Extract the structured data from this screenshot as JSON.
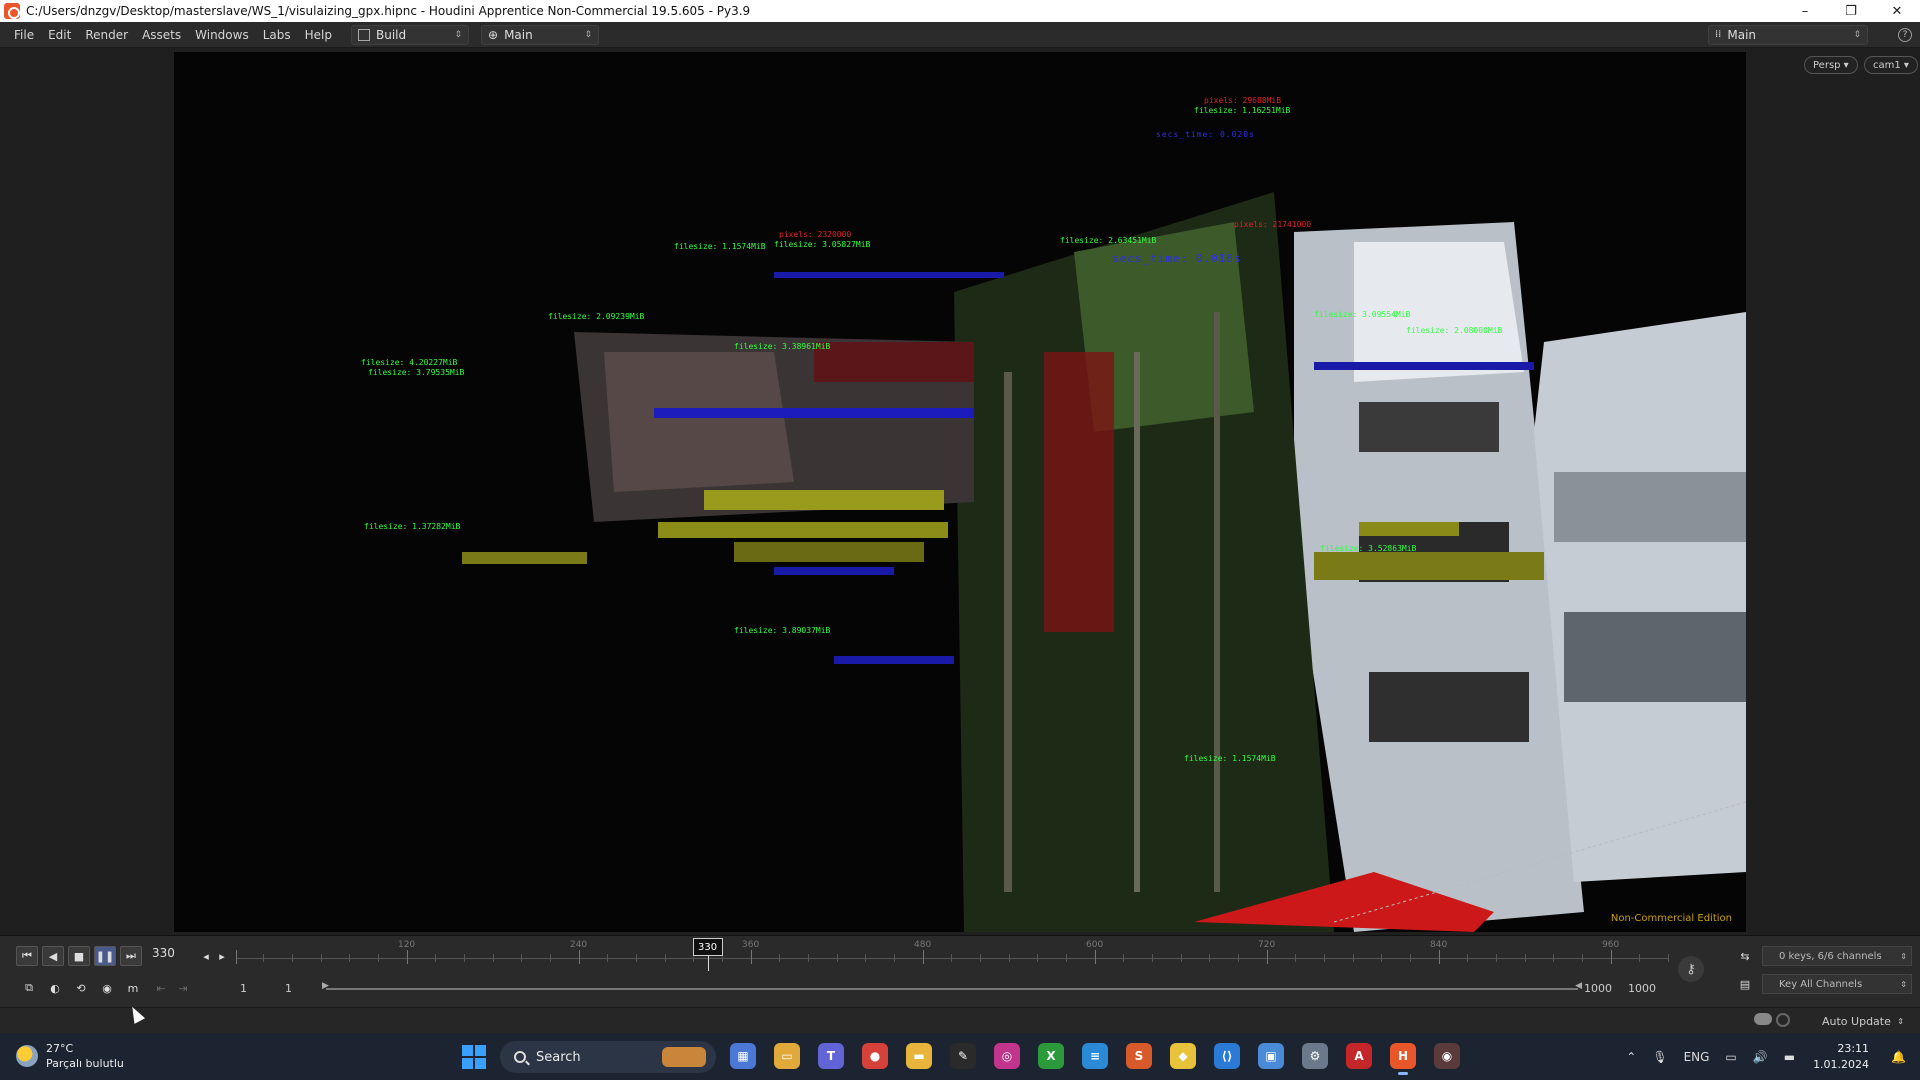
{
  "window": {
    "title": "C:/Users/dnzgv/Desktop/masterslave/WS_1/visulaizing_gpx.hipnc - Houdini Apprentice Non-Commercial 19.5.605 - Py3.9",
    "minimize": "–",
    "maximize": "❐",
    "close": "✕"
  },
  "menu": {
    "items": [
      "File",
      "Edit",
      "Render",
      "Assets",
      "Windows",
      "Labs",
      "Help"
    ],
    "desktop_build": "Build",
    "desktop_main": "Main",
    "desktop_right": "Main",
    "help": "?"
  },
  "viewport": {
    "camera_view": "Persp ▾",
    "camera": "cam1 ▾",
    "watermark": "Non-Commercial Edition",
    "labels": [
      {
        "text": "filesize: 1.1574MiB",
        "color": "green"
      },
      {
        "text": "filesize: 1.16251MiB",
        "color": "green"
      },
      {
        "text": "filesize: 3.05827MiB",
        "color": "green"
      },
      {
        "text": "filesize: 2.09239MiB",
        "color": "green"
      },
      {
        "text": "filesize: 4.20227MiB",
        "color": "green"
      },
      {
        "text": "filesize: 3.79535MiB",
        "color": "green"
      },
      {
        "text": "filesize: 3.38961MiB",
        "color": "green"
      },
      {
        "text": "filesize: 3.09554MiB",
        "color": "green"
      },
      {
        "text": "filesize: 2.08000MiB",
        "color": "green"
      },
      {
        "text": "filesize: 1.37282MiB",
        "color": "green"
      },
      {
        "text": "filesize: 3.89037MiB",
        "color": "green"
      },
      {
        "text": "filesize: 2.63451MiB",
        "color": "green"
      },
      {
        "text": "filesize: 3.52863MiB",
        "color": "green"
      },
      {
        "text": "pixels: 29688MiB",
        "color": "red"
      },
      {
        "text": "pixels: 2320000",
        "color": "red"
      },
      {
        "text": "pixels: 21741000",
        "color": "red"
      },
      {
        "text": "secs_time: 0.016s",
        "color": "blue"
      },
      {
        "text": "secs_time: 0.020s",
        "color": "blue"
      }
    ]
  },
  "playbar": {
    "current_frame": "330",
    "cursor_frame": "330",
    "tick_labels": [
      "120",
      "240",
      "330",
      "360",
      "480",
      "600",
      "720",
      "840",
      "960"
    ],
    "range_start": "1",
    "range_start2": "1",
    "range_end": "1000",
    "range_end2": "1000",
    "keys_info": "0 keys, 6/6 channels",
    "key_channels": "Key All Channels",
    "auto_update": "Auto Update"
  },
  "taskbar": {
    "weather_temp": "27°C",
    "weather_desc": "Parçalı bulutlu",
    "search": "Search",
    "lang": "ENG",
    "time": "23:11",
    "date": "1.01.2024",
    "apps": [
      {
        "name": "widgets-app-icon",
        "color": "#4a78d4",
        "glyph": "▦"
      },
      {
        "name": "file-explorer-icon",
        "color": "#e0a93a",
        "glyph": "▭"
      },
      {
        "name": "teams-icon",
        "color": "#6264d6",
        "glyph": "T"
      },
      {
        "name": "chrome-icon",
        "color": "#d6423a",
        "glyph": "●"
      },
      {
        "name": "folder-icon",
        "color": "#e8b43c",
        "glyph": "▬"
      },
      {
        "name": "inkscape-icon",
        "color": "#2a2a2a",
        "glyph": "✎"
      },
      {
        "name": "instagram-icon",
        "color": "#c1358c",
        "glyph": "◎"
      },
      {
        "name": "xbox-icon",
        "color": "#2a9a3a",
        "glyph": "X"
      },
      {
        "name": "notepad-icon",
        "color": "#2a8ad6",
        "glyph": "≡"
      },
      {
        "name": "substance-icon",
        "color": "#d65a2a",
        "glyph": "S"
      },
      {
        "name": "git-icon",
        "color": "#e8c23a",
        "glyph": "◆"
      },
      {
        "name": "vscode-icon",
        "color": "#2a7ad6",
        "glyph": "⟨⟩"
      },
      {
        "name": "remote-desktop-icon",
        "color": "#4a8ad6",
        "glyph": "▣"
      },
      {
        "name": "settings-icon",
        "color": "#6a7a8a",
        "glyph": "⚙"
      },
      {
        "name": "acrobat-icon",
        "color": "#c4262a",
        "glyph": "A"
      },
      {
        "name": "houdini-icon",
        "color": "#e8562a",
        "glyph": "H"
      },
      {
        "name": "sidefx-launcher-icon",
        "color": "#5a3a3a",
        "glyph": "◉"
      }
    ]
  }
}
